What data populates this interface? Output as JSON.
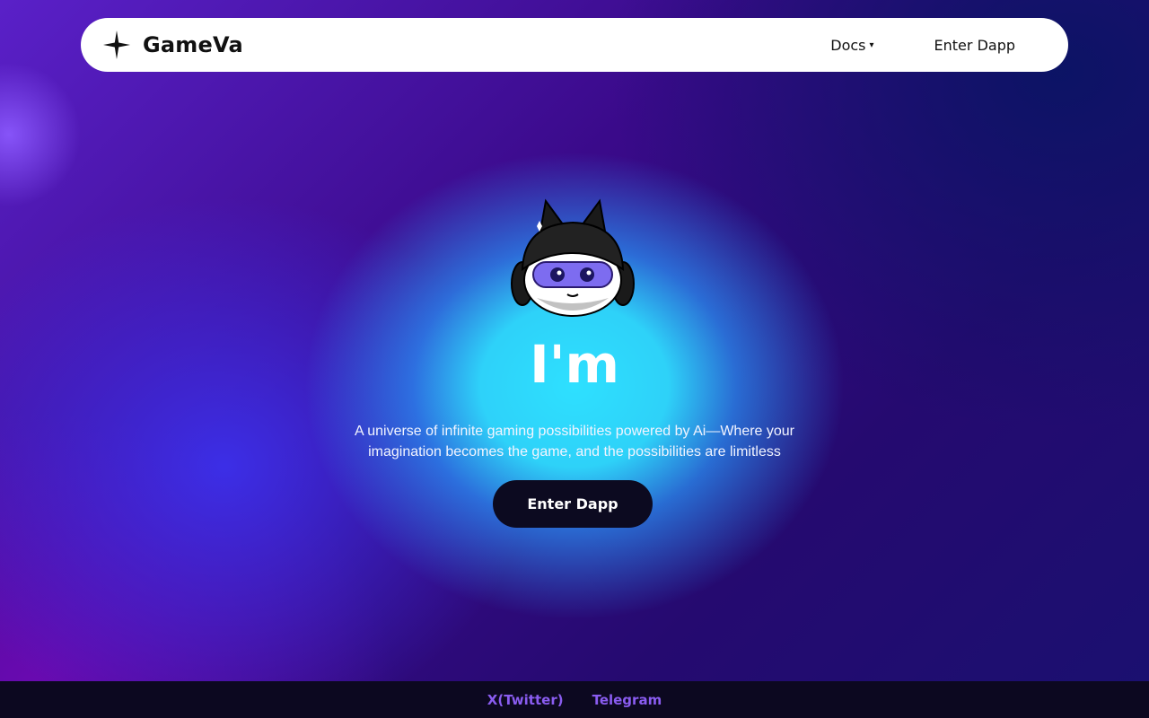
{
  "nav": {
    "brand": "GameVa",
    "brand_icon": "four-point-star-icon",
    "docs_label": "Docs",
    "docs_caret": "▾",
    "enter_label": "Enter Dapp"
  },
  "hero": {
    "mascot_icon": "cat-mascot-icon",
    "headline": "I'm",
    "subtitle": "A universe of infinite gaming possibilities powered by Ai—Where your imagination becomes the game, and the possibilities are limitless",
    "cta_label": "Enter Dapp"
  },
  "footer": {
    "links": [
      "X(Twitter)",
      "Telegram"
    ]
  },
  "colors": {
    "accent_link": "#8a5cf0",
    "cta_bg": "#0c0a20",
    "glow": "#2ee0ff"
  }
}
